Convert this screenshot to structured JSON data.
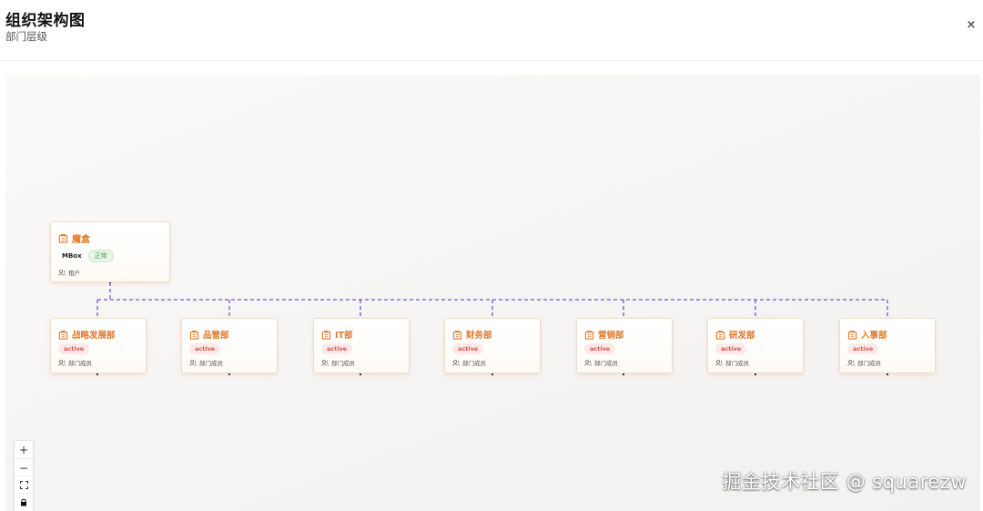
{
  "header": {
    "title": "组织架构图",
    "subtitle": "部门层级",
    "close_symbol": "×"
  },
  "root": {
    "name": "魔盒",
    "code": "MBox",
    "status": "正常",
    "footer": "租户",
    "icon": "org-building-icon"
  },
  "departments": [
    {
      "name": "战略发展部",
      "status": "active",
      "footer": "部门成员"
    },
    {
      "name": "品管部",
      "status": "active",
      "footer": "部门成员"
    },
    {
      "name": "IT部",
      "status": "active",
      "footer": "部门成员"
    },
    {
      "name": "财务部",
      "status": "active",
      "footer": "部门成员"
    },
    {
      "name": "营销部",
      "status": "active",
      "footer": "部门成员"
    },
    {
      "name": "研发部",
      "status": "active",
      "footer": "部门成员"
    },
    {
      "name": "入事部",
      "status": "active",
      "footer": "部门成员"
    }
  ],
  "controls": {
    "zoom_in": "+",
    "zoom_out": "−",
    "fit_view": "⛶",
    "lock": "🔒"
  },
  "colors": {
    "accent": "#e07a2c",
    "edge": "#6a5acd",
    "status_ok": "#4a9a52",
    "active": "#d9534f"
  },
  "watermark": "掘金技术社区 @ squarezw"
}
